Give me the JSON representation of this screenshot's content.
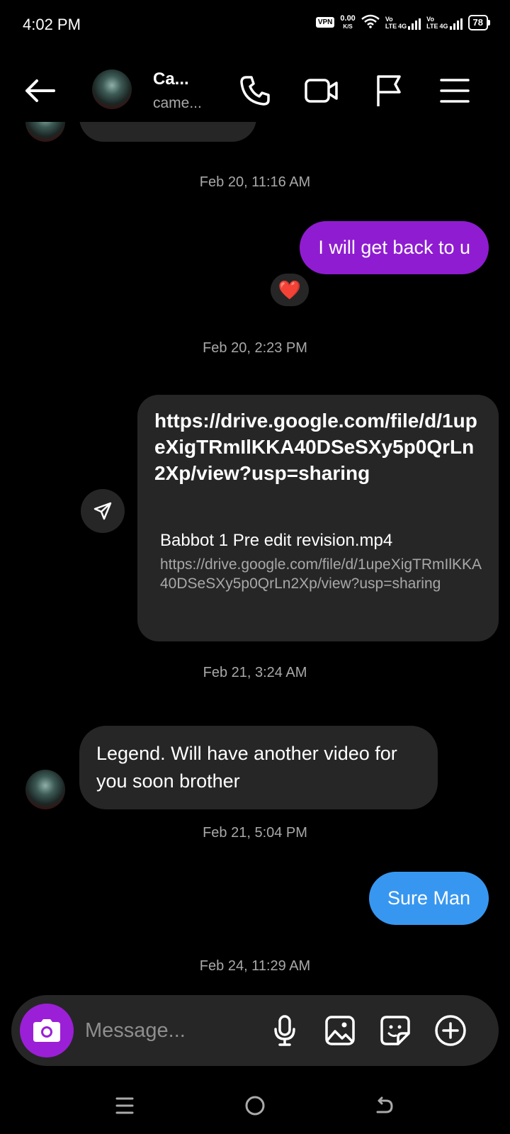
{
  "status_bar": {
    "time": "4:02 PM",
    "vpn": "VPN",
    "net_speed_value": "0.00",
    "net_speed_unit": "K/S",
    "sim1_top": "Vo",
    "sim1_bottom": "LTE",
    "sim1_type": "4G",
    "sim2_top": "Vo",
    "sim2_bottom": "LTE",
    "sim2_type": "4G",
    "battery": "78"
  },
  "header": {
    "name": "Ca...",
    "handle": "came..."
  },
  "messages": {
    "ts1": "Feb 20, 11:16 AM",
    "msg1": "I will get back to u",
    "msg1_reaction": "❤️",
    "ts2": "Feb 20, 2:23 PM",
    "link_url": "https://drive.google.com/file/d/1upeXigTRmIlKKA40DSeSXy5p0QrLn2Xp/view?usp=sharing",
    "preview_title": "Babbot 1 Pre edit revision.mp4",
    "preview_url": "https://drive.google.com/file/d/1upeXigTRmIlKKA40DSeSXy5p0QrLn2Xp/view?usp=sharing",
    "ts3": "Feb 21, 3:24 AM",
    "msg_in": "Legend. Will have another video for you soon brother",
    "ts4": "Feb 21, 5:04 PM",
    "msg_sure": "Sure Man",
    "ts5": "Feb 24, 11:29 AM"
  },
  "composer": {
    "placeholder": "Message..."
  },
  "colors": {
    "outgoing_purple": "#8f1cd1",
    "outgoing_blue": "#3797f0",
    "incoming_bubble": "#262626",
    "camera_button": "#9b1fd6"
  }
}
